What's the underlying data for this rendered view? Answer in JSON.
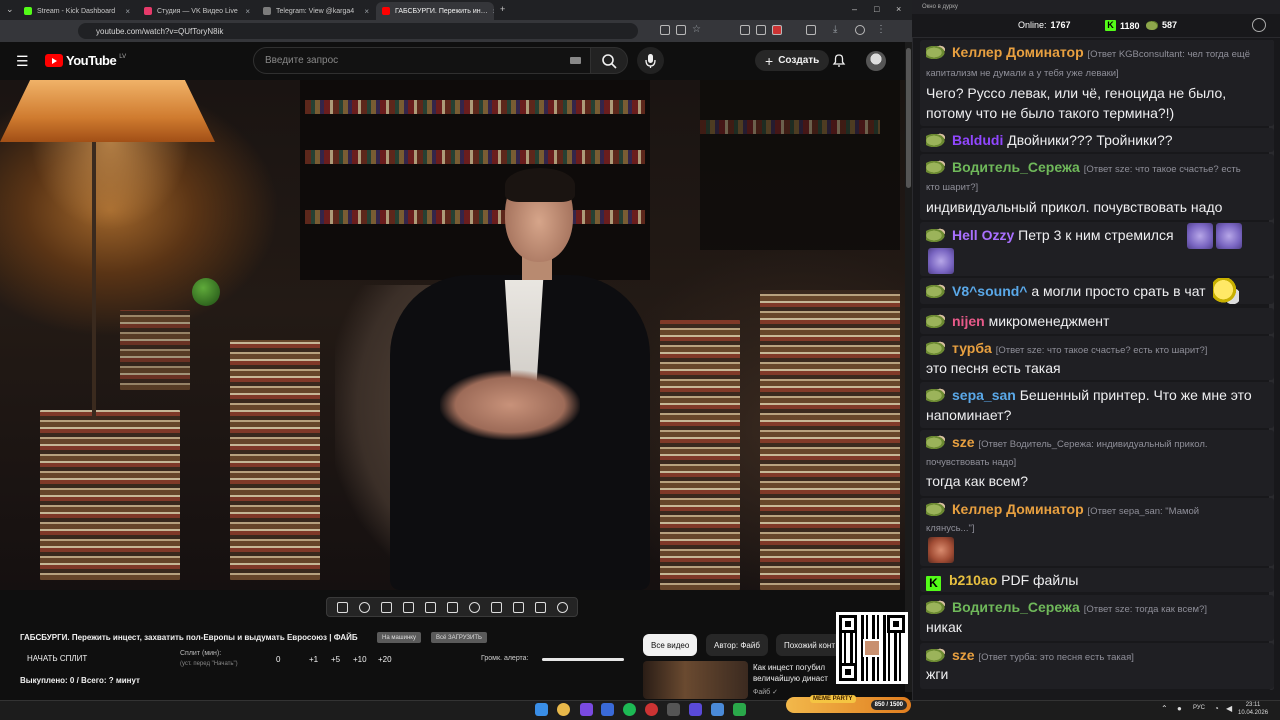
{
  "browser": {
    "tabs": [
      {
        "title": "Stream - Kick Dashboard",
        "color": "#53fc18"
      },
      {
        "title": "Студия — VK Видео Live",
        "color": "#e63a6a"
      },
      {
        "title": "Telegram: View @karga4",
        "color": "#555"
      },
      {
        "title": "ГАБСБУРГИ. Пережить ин…",
        "color": "#ff0000"
      }
    ],
    "url": "youtube.com/watch?v=QUfToryN8ik",
    "new_tab": "+"
  },
  "youtube": {
    "logo_text": "YouTube",
    "country": "LV",
    "search_placeholder": "Введите запрос",
    "create_label": "Создать",
    "plus": "+",
    "video_title": "ГАБСБУРГИ. Пережить инцест, захватить пол-Европы и выдумать Евросоюз | ФАЙБ",
    "pill_a": "На машинку",
    "pill_b": "Всё ЗАГРУЗИТЬ",
    "split_button": "НАЧАТЬ СПЛИТ",
    "split_label": "Сплит (мин):",
    "split_sub": "(уст. перед \"Начать\")",
    "split_value": "0",
    "increments": [
      "+1",
      "+5",
      "+10",
      "+20"
    ],
    "alert_volume_label": "Громк. алерта:",
    "alert_volume": 1.0,
    "bought_label": "Выкуплено: 0 / Всего: ? минут",
    "chips": [
      "Все видео",
      "Автор: Файб",
      "Похожий конт"
    ],
    "rec_title_1": "Как инцест погубил",
    "rec_title_2": "величайшую династ",
    "rec_channel": "Файб ✓"
  },
  "chat": {
    "window_title": "Окно в дурку",
    "online_label": "Online:",
    "online_count": "1767",
    "kick_count": "1180",
    "pepe_count": "587",
    "messages": [
      {
        "user": "Келлер Доминатор",
        "color": "#e8a040",
        "reply": "[Ответ KGBconsultant: чел тогда ещё",
        "reply2": "капитализм не думали а у тебя уже леваки]",
        "text": "Чего? Руссо левак, или чё, геноцида не было,",
        "text2": "потому что не было такого термина?!)"
      },
      {
        "user": "Baldudi",
        "color": "#9147ff",
        "text": "Двойники??? Тройники??"
      },
      {
        "user": "Водитель_Сережа",
        "color": "#6fb85a",
        "reply": "[Ответ sze: что такое счастье? есть",
        "reply2": "кто шарит?]",
        "text": "индивидуальный прикол. почувствовать надо"
      },
      {
        "user": "Hell Ozzy",
        "color": "#a970ff",
        "text": "Петр 3 к ним стремился"
      },
      {
        "user": "V8^sound^",
        "color": "#5aa8e8",
        "text": "а могли просто срать в чат"
      },
      {
        "user": "nijen",
        "color": "#e85a8a",
        "text": "микроменеджмент"
      },
      {
        "user": "турба",
        "color": "#e8a040",
        "reply": "[Ответ sze: что такое счастье? есть кто шарит?]",
        "text": "это песня есть такая"
      },
      {
        "user": "sepa_san",
        "color": "#5aa8e8",
        "text": "Бешенный принтер. Что же мне это",
        "text2": "напоминает?"
      },
      {
        "user": "sze",
        "color": "#e8a040",
        "reply": "[Ответ Водитель_Сережа: индивидуальный прикол.",
        "reply2": "почувствовать надо]",
        "text": "тогда как всем?"
      },
      {
        "user": "Келлер Доминатор",
        "color": "#e8a040",
        "reply": "[Ответ sepa_san: \"Мамой",
        "reply2": "клянусь...\"]"
      },
      {
        "user": "b210ao",
        "color": "#e8c040",
        "text": "PDF файлы"
      },
      {
        "user": "Водитель_Сережа",
        "color": "#6fb85a",
        "reply": "[Ответ sze: тогда как всем?]",
        "text": "никак"
      },
      {
        "user": "sze",
        "color": "#e8a040",
        "reply": "[Ответ турба: это песня есть такая]",
        "text": "жги"
      }
    ]
  },
  "taskbar": {
    "meme_label": "MEME PARTY",
    "meme_count": "850 / 1500",
    "lang": "РУС",
    "time": "23:11",
    "date": "10.04.2026"
  },
  "colors": {
    "accent_red": "#ff0000",
    "kick_green": "#53fc18",
    "chat_bg": "#18181b"
  }
}
